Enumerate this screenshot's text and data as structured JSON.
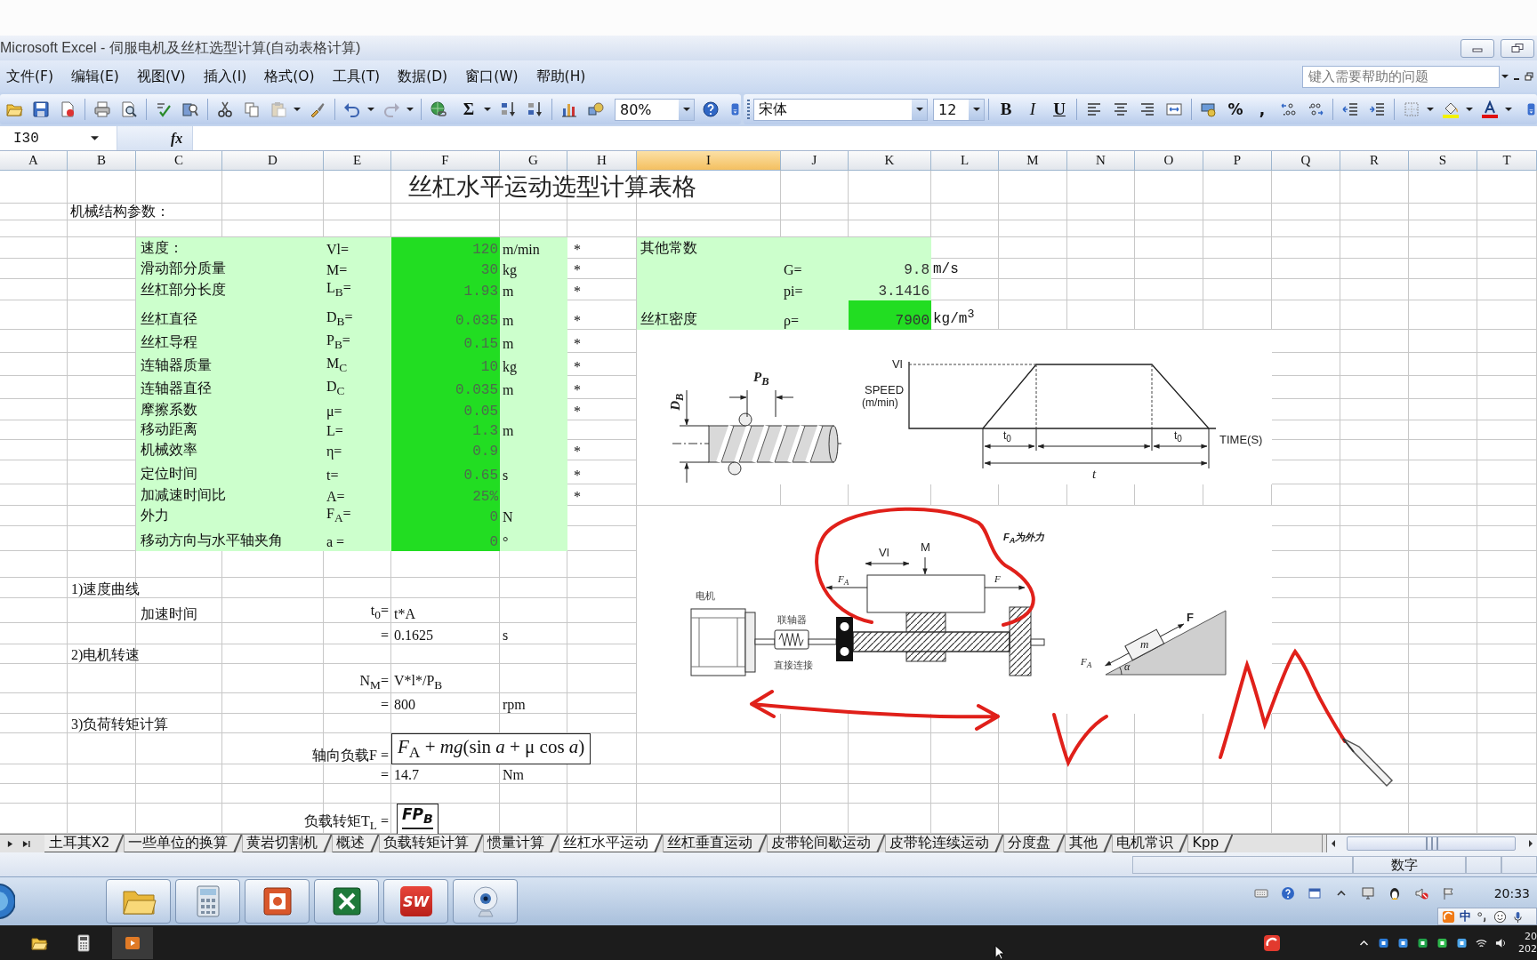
{
  "window": {
    "title": "Microsoft Excel - 伺服电机及丝杠选型计算(自动表格计算)"
  },
  "menu": [
    "文件(F)",
    "编辑(E)",
    "视图(V)",
    "插入(I)",
    "格式(O)",
    "工具(T)",
    "数据(D)",
    "窗口(W)",
    "帮助(H)"
  ],
  "help_search": {
    "placeholder": "键入需要帮助的问题"
  },
  "toolbar": {
    "autosum": "Σ",
    "zoom": "80%",
    "font": "宋体",
    "font_size": "12",
    "style_buttons": [
      "B",
      "I",
      "U"
    ],
    "number_buttons": [
      "%",
      ","
    ]
  },
  "formula_bar": {
    "name_box": "I30",
    "function_label": "fx"
  },
  "columns": [
    {
      "label": "A",
      "selected": false
    },
    {
      "label": "B",
      "selected": false
    },
    {
      "label": "C",
      "selected": false
    },
    {
      "label": "D",
      "selected": false
    },
    {
      "label": "E",
      "selected": false
    },
    {
      "label": "F",
      "selected": false
    },
    {
      "label": "G",
      "selected": false
    },
    {
      "label": "H",
      "selected": false
    },
    {
      "label": "I",
      "selected": true
    },
    {
      "label": "J",
      "selected": false
    },
    {
      "label": "K",
      "selected": false
    },
    {
      "label": "L",
      "selected": false
    },
    {
      "label": "M",
      "selected": false
    },
    {
      "label": "N",
      "selected": false
    },
    {
      "label": "O",
      "selected": false
    },
    {
      "label": "P",
      "selected": false
    },
    {
      "label": "Q",
      "selected": false
    },
    {
      "label": "R",
      "selected": false
    },
    {
      "label": "S",
      "selected": false
    },
    {
      "label": "T",
      "selected": false
    }
  ],
  "sheet": {
    "title": "丝杠水平运动选型计算表格",
    "section_label": "机械结构参数：",
    "parameters": [
      {
        "name": "速度：",
        "symbol": "Vl=",
        "value": "120",
        "unit": "m/min",
        "input": true,
        "note": "*"
      },
      {
        "name": "滑动部分质量",
        "symbol": "M=",
        "value": "30",
        "unit": "kg",
        "input": true,
        "note": "*"
      },
      {
        "name": "丝杠部分长度",
        "symbol": "L$_{B}$=",
        "value": "1.93",
        "unit": "m",
        "input": true,
        "note": "*"
      },
      {
        "name": "丝杠直径",
        "symbol": "D$_{B}$=",
        "value": "0.035",
        "unit": "m",
        "input": true,
        "note": "*"
      },
      {
        "name": "丝杠导程",
        "symbol": "P$_{B}$=",
        "value": "0.15",
        "unit": "m",
        "input": true,
        "note": "*"
      },
      {
        "name": "连轴器质量",
        "symbol": "M$_{C}$",
        "value": "10",
        "unit": "kg",
        "input": true,
        "note": "*"
      },
      {
        "name": "连轴器直径",
        "symbol": "D$_{C}$",
        "value": "0.035",
        "unit": "m",
        "input": true,
        "note": "*"
      },
      {
        "name": "摩擦系数",
        "symbol": "μ=",
        "value": "0.05",
        "input": true,
        "note": "*"
      },
      {
        "name": "移动距离",
        "symbol": "L=",
        "value": "1.3",
        "unit": "m",
        "input": true
      },
      {
        "name": "机械效率",
        "symbol": "η=",
        "value": "0.9",
        "input": true,
        "note": "*"
      },
      {
        "name": "定位时间",
        "symbol": "t=",
        "value": "0.65",
        "unit": "s",
        "input": true,
        "note": "*"
      },
      {
        "name": "加减速时间比",
        "symbol": "A=",
        "value": "25%",
        "input": true,
        "note": "*"
      },
      {
        "name": "外力",
        "symbol": "F$_{A}$=",
        "value": "0",
        "unit": "N",
        "input": true
      },
      {
        "name": "移动方向与水平轴夹角",
        "symbol": "a =",
        "value": "0",
        "unit": "°",
        "input": true
      }
    ],
    "constants": [
      {
        "name": "其他常数"
      },
      {
        "symbol": "G=",
        "value": "9.8",
        "unit": "m/s",
        "input": false
      },
      {
        "symbol": "pi=",
        "value": "3.1416",
        "input": false
      },
      {
        "name": "丝杠密度",
        "symbol": "ρ=",
        "value": "7900",
        "unit": "kg/m$^{3}$",
        "input": true
      }
    ],
    "calculations": [
      {
        "heading": "1)速度曲线",
        "lines": [
          {
            "kind": "value",
            "label": "加速时间",
            "symbol": "t$_{0}$=",
            "value": "t*A"
          },
          {
            "kind": "value",
            "symbol": "=",
            "value": "0.1625",
            "unit": "s"
          }
        ]
      },
      {
        "heading": "2)电机转速",
        "lines": [
          {
            "kind": "value",
            "symbol": "N$_{M}$=",
            "value": "V*l*/P$_{B}$"
          },
          {
            "kind": "value",
            "symbol": "=",
            "value": "800",
            "unit": "rpm"
          }
        ]
      },
      {
        "heading": "3)负荷转矩计算",
        "lines": [
          {
            "kind": "equation",
            "symbol": "轴向负载F =",
            "value": "*F*$_{A}$ + *mg*(sin *a* + μ cos *a*)"
          },
          {
            "kind": "value",
            "symbol": "=",
            "value": "14.7",
            "unit": "Nm"
          },
          {
            "kind": "fraction",
            "symbol": "负载转矩T$_{L}$ =",
            "value": "*FP*$_{B}$"
          }
        ]
      }
    ]
  },
  "diagrams": {
    "screw": {
      "diameter": "D$_{B}$",
      "lead": "P$_{B}$"
    },
    "speed_profile": {
      "peak": "Vl",
      "y_axis": "SPEED",
      "y_axis_unit": "(m/min)",
      "accel_time": "t$_{0}$",
      "decel_time": "t$_{0}$",
      "x_axis": "TIME(S)",
      "total_time": "t"
    },
    "mechanism": {
      "motor": "电机",
      "coupling": "联轴器",
      "connection": "直接连接",
      "speed": "Vl",
      "mass": "M",
      "external_force": "F$_{A}$",
      "force": "F",
      "note": "F$_{A}$为外力"
    },
    "incline": {
      "mass": "m",
      "force": "F",
      "external_force": "F$_{A}$",
      "angle": "α"
    }
  },
  "sheet_tabs": [
    {
      "label": "土耳其X2",
      "selected": false
    },
    {
      "label": "一些单位的换算",
      "selected": false
    },
    {
      "label": "黄岩切割机",
      "selected": false
    },
    {
      "label": "概述",
      "selected": false
    },
    {
      "label": "负载转矩计算",
      "selected": false
    },
    {
      "label": "惯量计算",
      "selected": false
    },
    {
      "label": "丝杠水平运动",
      "selected": true
    },
    {
      "label": "丝杠垂直运动",
      "selected": false
    },
    {
      "label": "皮带轮间歇运动",
      "selected": false
    },
    {
      "label": "皮带轮连续运动",
      "selected": false
    },
    {
      "label": "分度盘",
      "selected": false
    },
    {
      "label": "其他",
      "selected": false
    },
    {
      "label": "电机常识",
      "selected": false
    },
    {
      "label": "Kpp",
      "selected": false
    }
  ],
  "status_bar": {
    "mode": "数字"
  },
  "taskbar": {
    "logo_text": "SW",
    "clock": "20:33",
    "ime_mode": "中"
  },
  "host_taskbar": {
    "clock_lines": [
      "20",
      "202"
    ]
  }
}
